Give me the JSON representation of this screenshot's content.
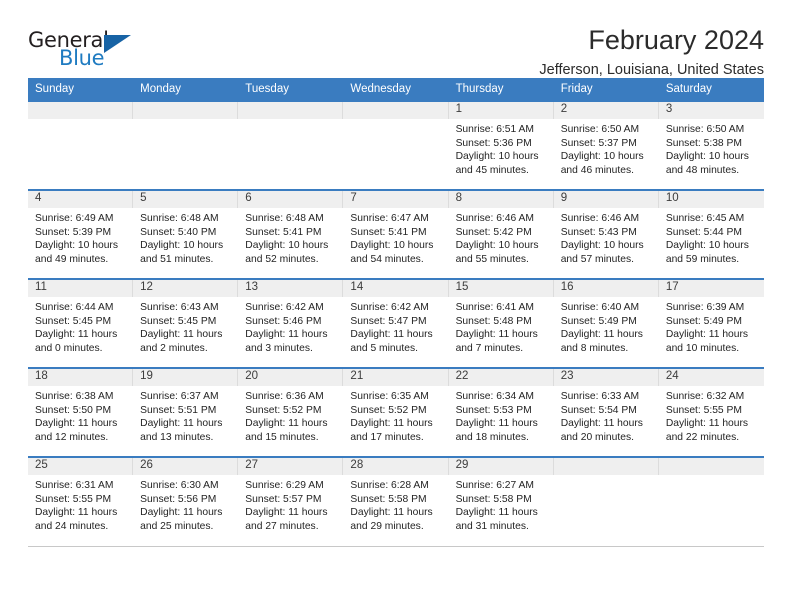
{
  "brand": {
    "name_top": "General",
    "name_bottom": "Blue",
    "triangle_icon": "blue-triangle-logo-mark",
    "accent_color": "#1763a5"
  },
  "header": {
    "title": "February 2024",
    "location": "Jefferson, Louisiana, United States"
  },
  "theme": {
    "header_blue": "#3a7cc0",
    "band_gray": "#efefef",
    "text_dark": "#242424"
  },
  "calendar": {
    "weekday_headers": [
      "Sunday",
      "Monday",
      "Tuesday",
      "Wednesday",
      "Thursday",
      "Friday",
      "Saturday"
    ],
    "weeks": [
      [
        {
          "day": "",
          "sunrise": "",
          "sunset": "",
          "daylight1": "",
          "daylight2": ""
        },
        {
          "day": "",
          "sunrise": "",
          "sunset": "",
          "daylight1": "",
          "daylight2": ""
        },
        {
          "day": "",
          "sunrise": "",
          "sunset": "",
          "daylight1": "",
          "daylight2": ""
        },
        {
          "day": "",
          "sunrise": "",
          "sunset": "",
          "daylight1": "",
          "daylight2": ""
        },
        {
          "day": "1",
          "sunrise": "Sunrise: 6:51 AM",
          "sunset": "Sunset: 5:36 PM",
          "daylight1": "Daylight: 10 hours",
          "daylight2": "and 45 minutes."
        },
        {
          "day": "2",
          "sunrise": "Sunrise: 6:50 AM",
          "sunset": "Sunset: 5:37 PM",
          "daylight1": "Daylight: 10 hours",
          "daylight2": "and 46 minutes."
        },
        {
          "day": "3",
          "sunrise": "Sunrise: 6:50 AM",
          "sunset": "Sunset: 5:38 PM",
          "daylight1": "Daylight: 10 hours",
          "daylight2": "and 48 minutes."
        }
      ],
      [
        {
          "day": "4",
          "sunrise": "Sunrise: 6:49 AM",
          "sunset": "Sunset: 5:39 PM",
          "daylight1": "Daylight: 10 hours",
          "daylight2": "and 49 minutes."
        },
        {
          "day": "5",
          "sunrise": "Sunrise: 6:48 AM",
          "sunset": "Sunset: 5:40 PM",
          "daylight1": "Daylight: 10 hours",
          "daylight2": "and 51 minutes."
        },
        {
          "day": "6",
          "sunrise": "Sunrise: 6:48 AM",
          "sunset": "Sunset: 5:41 PM",
          "daylight1": "Daylight: 10 hours",
          "daylight2": "and 52 minutes."
        },
        {
          "day": "7",
          "sunrise": "Sunrise: 6:47 AM",
          "sunset": "Sunset: 5:41 PM",
          "daylight1": "Daylight: 10 hours",
          "daylight2": "and 54 minutes."
        },
        {
          "day": "8",
          "sunrise": "Sunrise: 6:46 AM",
          "sunset": "Sunset: 5:42 PM",
          "daylight1": "Daylight: 10 hours",
          "daylight2": "and 55 minutes."
        },
        {
          "day": "9",
          "sunrise": "Sunrise: 6:46 AM",
          "sunset": "Sunset: 5:43 PM",
          "daylight1": "Daylight: 10 hours",
          "daylight2": "and 57 minutes."
        },
        {
          "day": "10",
          "sunrise": "Sunrise: 6:45 AM",
          "sunset": "Sunset: 5:44 PM",
          "daylight1": "Daylight: 10 hours",
          "daylight2": "and 59 minutes."
        }
      ],
      [
        {
          "day": "11",
          "sunrise": "Sunrise: 6:44 AM",
          "sunset": "Sunset: 5:45 PM",
          "daylight1": "Daylight: 11 hours",
          "daylight2": "and 0 minutes."
        },
        {
          "day": "12",
          "sunrise": "Sunrise: 6:43 AM",
          "sunset": "Sunset: 5:45 PM",
          "daylight1": "Daylight: 11 hours",
          "daylight2": "and 2 minutes."
        },
        {
          "day": "13",
          "sunrise": "Sunrise: 6:42 AM",
          "sunset": "Sunset: 5:46 PM",
          "daylight1": "Daylight: 11 hours",
          "daylight2": "and 3 minutes."
        },
        {
          "day": "14",
          "sunrise": "Sunrise: 6:42 AM",
          "sunset": "Sunset: 5:47 PM",
          "daylight1": "Daylight: 11 hours",
          "daylight2": "and 5 minutes."
        },
        {
          "day": "15",
          "sunrise": "Sunrise: 6:41 AM",
          "sunset": "Sunset: 5:48 PM",
          "daylight1": "Daylight: 11 hours",
          "daylight2": "and 7 minutes."
        },
        {
          "day": "16",
          "sunrise": "Sunrise: 6:40 AM",
          "sunset": "Sunset: 5:49 PM",
          "daylight1": "Daylight: 11 hours",
          "daylight2": "and 8 minutes."
        },
        {
          "day": "17",
          "sunrise": "Sunrise: 6:39 AM",
          "sunset": "Sunset: 5:49 PM",
          "daylight1": "Daylight: 11 hours",
          "daylight2": "and 10 minutes."
        }
      ],
      [
        {
          "day": "18",
          "sunrise": "Sunrise: 6:38 AM",
          "sunset": "Sunset: 5:50 PM",
          "daylight1": "Daylight: 11 hours",
          "daylight2": "and 12 minutes."
        },
        {
          "day": "19",
          "sunrise": "Sunrise: 6:37 AM",
          "sunset": "Sunset: 5:51 PM",
          "daylight1": "Daylight: 11 hours",
          "daylight2": "and 13 minutes."
        },
        {
          "day": "20",
          "sunrise": "Sunrise: 6:36 AM",
          "sunset": "Sunset: 5:52 PM",
          "daylight1": "Daylight: 11 hours",
          "daylight2": "and 15 minutes."
        },
        {
          "day": "21",
          "sunrise": "Sunrise: 6:35 AM",
          "sunset": "Sunset: 5:52 PM",
          "daylight1": "Daylight: 11 hours",
          "daylight2": "and 17 minutes."
        },
        {
          "day": "22",
          "sunrise": "Sunrise: 6:34 AM",
          "sunset": "Sunset: 5:53 PM",
          "daylight1": "Daylight: 11 hours",
          "daylight2": "and 18 minutes."
        },
        {
          "day": "23",
          "sunrise": "Sunrise: 6:33 AM",
          "sunset": "Sunset: 5:54 PM",
          "daylight1": "Daylight: 11 hours",
          "daylight2": "and 20 minutes."
        },
        {
          "day": "24",
          "sunrise": "Sunrise: 6:32 AM",
          "sunset": "Sunset: 5:55 PM",
          "daylight1": "Daylight: 11 hours",
          "daylight2": "and 22 minutes."
        }
      ],
      [
        {
          "day": "25",
          "sunrise": "Sunrise: 6:31 AM",
          "sunset": "Sunset: 5:55 PM",
          "daylight1": "Daylight: 11 hours",
          "daylight2": "and 24 minutes."
        },
        {
          "day": "26",
          "sunrise": "Sunrise: 6:30 AM",
          "sunset": "Sunset: 5:56 PM",
          "daylight1": "Daylight: 11 hours",
          "daylight2": "and 25 minutes."
        },
        {
          "day": "27",
          "sunrise": "Sunrise: 6:29 AM",
          "sunset": "Sunset: 5:57 PM",
          "daylight1": "Daylight: 11 hours",
          "daylight2": "and 27 minutes."
        },
        {
          "day": "28",
          "sunrise": "Sunrise: 6:28 AM",
          "sunset": "Sunset: 5:58 PM",
          "daylight1": "Daylight: 11 hours",
          "daylight2": "and 29 minutes."
        },
        {
          "day": "29",
          "sunrise": "Sunrise: 6:27 AM",
          "sunset": "Sunset: 5:58 PM",
          "daylight1": "Daylight: 11 hours",
          "daylight2": "and 31 minutes."
        },
        {
          "day": "",
          "sunrise": "",
          "sunset": "",
          "daylight1": "",
          "daylight2": ""
        },
        {
          "day": "",
          "sunrise": "",
          "sunset": "",
          "daylight1": "",
          "daylight2": ""
        }
      ]
    ]
  }
}
